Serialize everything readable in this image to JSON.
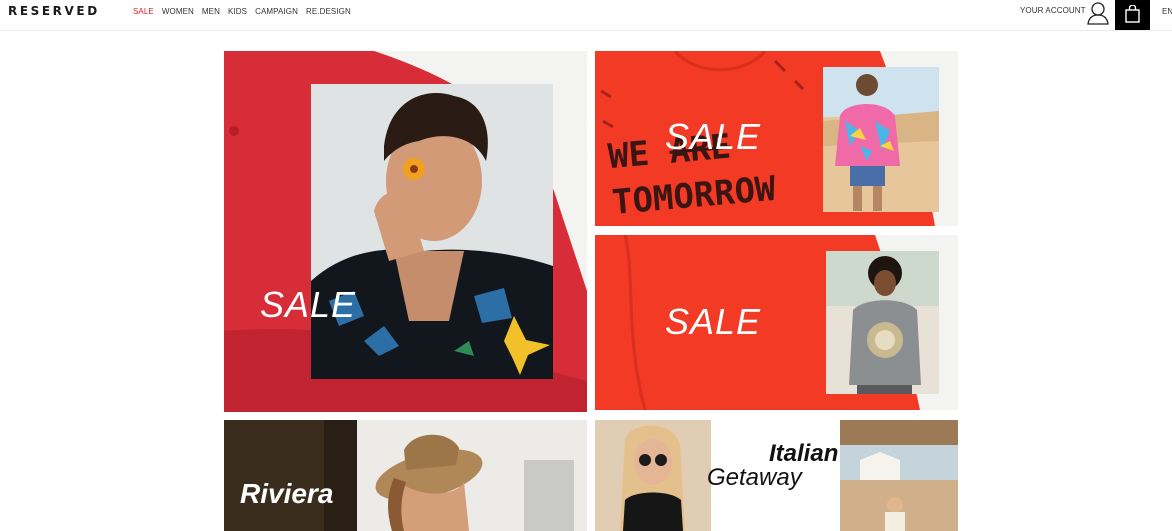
{
  "brand": "RESERVED",
  "nav": {
    "items": [
      {
        "label": "SALE",
        "highlight": true
      },
      {
        "label": "WOMEN",
        "highlight": false
      },
      {
        "label": "MEN",
        "highlight": false
      },
      {
        "label": "KIDS",
        "highlight": false
      },
      {
        "label": "CAMPAIGN",
        "highlight": false
      },
      {
        "label": "RE.DESIGN",
        "highlight": false
      }
    ]
  },
  "header_right": {
    "account_label": "YOUR ACCOUNT",
    "user_icon": "user-icon",
    "cart_icon": "shopping-bag-icon",
    "language": "EN"
  },
  "colors": {
    "accent": "#e21f26",
    "sale_red": "#f23a24",
    "cap_red": "#d72d38"
  },
  "tiles": {
    "men_sale": {
      "text": "SALE",
      "image": "man in floral shirt holding flower"
    },
    "women_sale": {
      "text": "SALE",
      "handwritten_line1_strike": "ARE",
      "handwritten_line1": "WE",
      "handwritten_line2": "TOMORROW",
      "image": "girl in colorful jacket on beach"
    },
    "kids_sale": {
      "text": "SALE",
      "image": "boy in lion t-shirt"
    },
    "riviera": {
      "text": "Riviera",
      "image": "woman in straw hat"
    },
    "italian": {
      "line1": "Italian",
      "line2": "Getaway",
      "image": "woman in sunglasses and seaside town"
    }
  }
}
